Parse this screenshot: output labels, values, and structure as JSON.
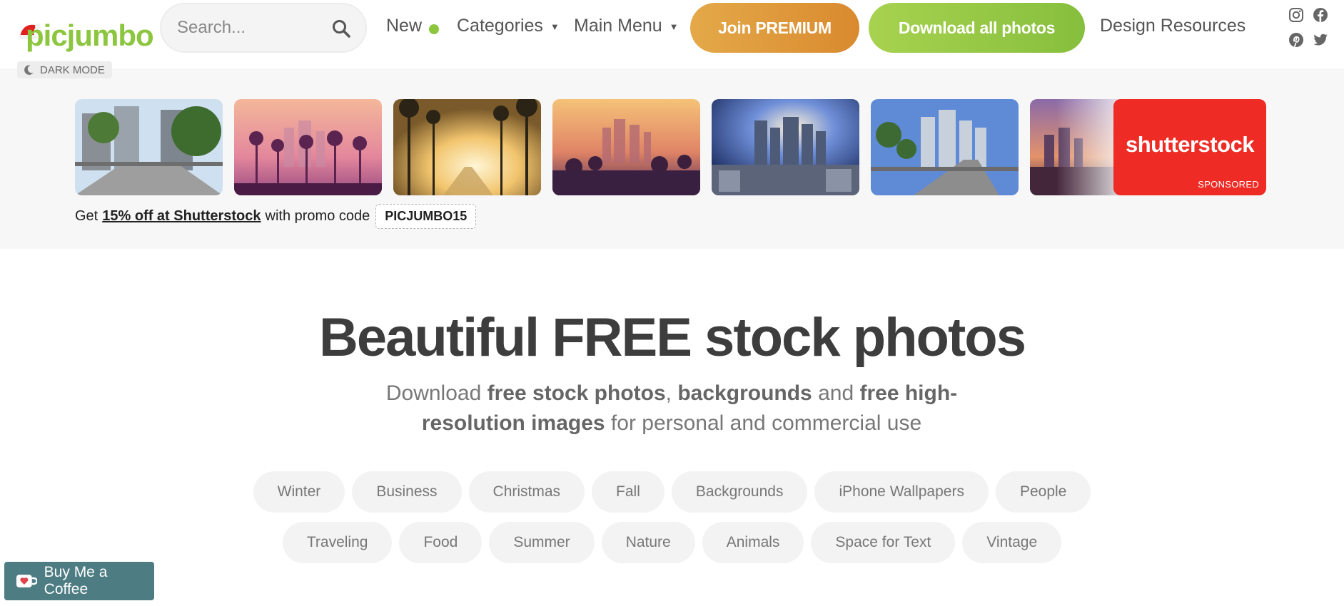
{
  "header": {
    "logo_text": "picjumbo",
    "search_placeholder": "Search...",
    "nav": {
      "new_label": "New",
      "categories_label": "Categories",
      "main_menu_label": "Main Menu",
      "design_resources_label": "Design Resources"
    },
    "premium_button": "Join PREMIUM",
    "download_button": "Download all photos",
    "social": [
      "instagram-icon",
      "facebook-icon",
      "pinterest-icon",
      "twitter-icon"
    ]
  },
  "dark_mode_label": "DARK MODE",
  "sponsored": {
    "brand": "shutterstock",
    "badge": "SPONSORED",
    "promo_prefix": "Get",
    "promo_link": "15% off at Shutterstock",
    "promo_middle": "with promo code",
    "promo_code": "PICJUMBO15"
  },
  "hero": {
    "title": "Beautiful FREE stock photos",
    "sub_1": "Download",
    "sub_b1": "free stock photos",
    "sub_2": ",",
    "sub_b2": "backgrounds",
    "sub_3": "and",
    "sub_b3": "free high-resolution images",
    "sub_4": "for personal and commercial use"
  },
  "tags_row1": [
    "Winter",
    "Business",
    "Christmas",
    "Fall",
    "Backgrounds",
    "iPhone Wallpapers",
    "People"
  ],
  "tags_row2": [
    "Traveling",
    "Food",
    "Summer",
    "Nature",
    "Animals",
    "Space for Text",
    "Vintage"
  ],
  "coffee_button": "Buy Me a Coffee",
  "colors": {
    "brand_green": "#8cc63f",
    "premium_orange": "#d98a2e",
    "shutterstock_red": "#ee2b24",
    "coffee_teal": "#4e7c83"
  }
}
